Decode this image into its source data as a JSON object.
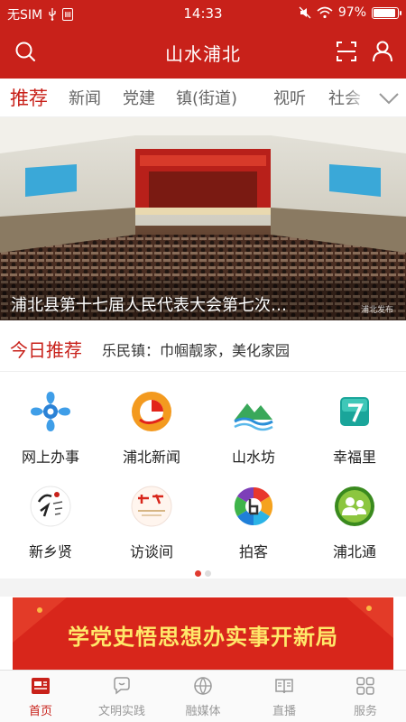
{
  "status_bar": {
    "carrier": "无SIM",
    "time": "14:33",
    "battery": "97%"
  },
  "header": {
    "title": "山水浦北",
    "icons": [
      "search-icon",
      "scan-icon",
      "user-icon"
    ]
  },
  "tabs": [
    {
      "label": "推荐",
      "active": true
    },
    {
      "label": "新闻",
      "active": false
    },
    {
      "label": "党建",
      "active": false
    },
    {
      "label": "镇(街道)",
      "active": false
    },
    {
      "label": "视听",
      "active": false
    },
    {
      "label": "社会",
      "active": false
    }
  ],
  "banner": {
    "caption": "浦北县第十七届人民代表大会第七次…",
    "watermark": "浦北发布"
  },
  "today": {
    "label": "今日推荐",
    "headline": "乐民镇：巾帼靓家，美化家园"
  },
  "services": [
    {
      "label": "网上办事",
      "icon": "online-service-icon"
    },
    {
      "label": "浦北新闻",
      "icon": "pubei-news-icon"
    },
    {
      "label": "山水坊",
      "icon": "shanshuifang-icon"
    },
    {
      "label": "幸福里",
      "icon": "xingfuli-icon"
    },
    {
      "label": "新乡贤",
      "icon": "xinxiangxian-icon"
    },
    {
      "label": "访谈间",
      "icon": "interview-icon"
    },
    {
      "label": "拍客",
      "icon": "camera-icon"
    },
    {
      "label": "浦北通",
      "icon": "pubeitong-icon"
    }
  ],
  "pagination": {
    "current": 1,
    "total": 2
  },
  "promo": {
    "slogan": "学党史悟思想办实事开新局"
  },
  "bottom_nav": [
    {
      "label": "首页",
      "icon": "home-icon",
      "active": true
    },
    {
      "label": "文明实践",
      "icon": "civilization-icon",
      "active": false
    },
    {
      "label": "融媒体",
      "icon": "media-icon",
      "active": false
    },
    {
      "label": "直播",
      "icon": "live-icon",
      "active": false
    },
    {
      "label": "服务",
      "icon": "services-grid-icon",
      "active": false
    }
  ],
  "colors": {
    "brand_red": "#c8211a",
    "active_dot": "#e03a2f",
    "promo_text": "#ffe86a"
  }
}
